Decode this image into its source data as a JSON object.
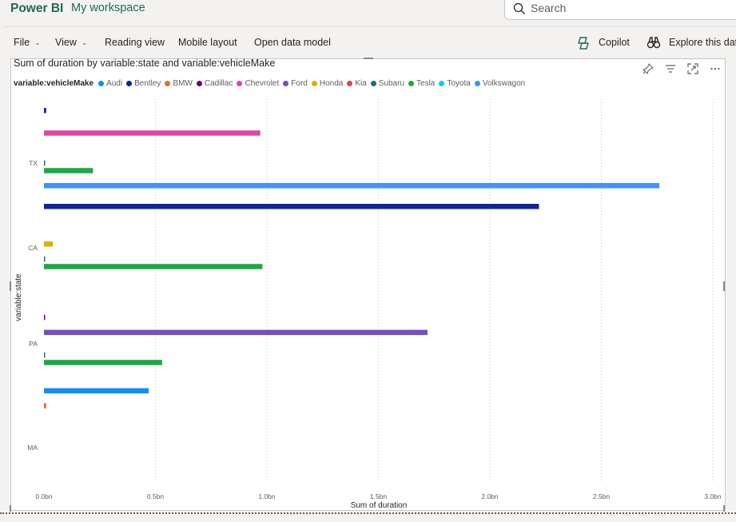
{
  "app": {
    "brand": "Power BI",
    "workspace": "My workspace"
  },
  "search": {
    "placeholder": "Search"
  },
  "toolbar": {
    "file": "File",
    "view": "View",
    "reading_view": "Reading view",
    "mobile_layout": "Mobile layout",
    "open_data_model": "Open data model",
    "copilot": "Copilot",
    "explore": "Explore this data"
  },
  "visual": {
    "title": "Sum of duration by variable:state and variable:vehicleMake",
    "legend_title": "variable:vehicleMake"
  },
  "colors": {
    "Audi": "#118dff",
    "Bentley": "#12239e",
    "BMW": "#e66c37",
    "Cadillac": "#6b007b",
    "Chevrolet": "#e044a7",
    "Ford": "#744ec2",
    "Honda": "#d9b300",
    "Kia": "#d64550",
    "Subaru": "#197278",
    "Tesla": "#1aab40",
    "Toyota": "#15c6f4",
    "Volkswagon": "#4092ff"
  },
  "chart_data": {
    "type": "bar",
    "orientation": "horizontal",
    "xlabel": "Sum of duration",
    "ylabel": "variable:state",
    "xlim": [
      0,
      3.0
    ],
    "x_unit": "bn",
    "x_ticks": [
      "0.0bn",
      "0.5bn",
      "1.0bn",
      "1.5bn",
      "2.0bn",
      "2.5bn",
      "3.0bn"
    ],
    "legend_position": "top-left",
    "grid": true,
    "categories": [
      "TX",
      "CA",
      "PA",
      "MA"
    ],
    "series_order": [
      "Audi",
      "Bentley",
      "BMW",
      "Cadillac",
      "Chevrolet",
      "Ford",
      "Honda",
      "Kia",
      "Subaru",
      "Tesla",
      "Toyota",
      "Volkswagon"
    ],
    "series": [
      {
        "name": "Audi",
        "values": [
          0,
          0,
          0,
          0.47
        ]
      },
      {
        "name": "Bentley",
        "values": [
          0.01,
          2.22,
          0,
          0
        ]
      },
      {
        "name": "BMW",
        "values": [
          0,
          0,
          0,
          0.01
        ]
      },
      {
        "name": "Cadillac",
        "values": [
          0,
          0,
          0.002,
          0
        ]
      },
      {
        "name": "Chevrolet",
        "values": [
          0.97,
          0,
          0,
          0
        ]
      },
      {
        "name": "Ford",
        "values": [
          0,
          0,
          1.72,
          0
        ]
      },
      {
        "name": "Honda",
        "values": [
          0,
          0.04,
          0,
          0
        ]
      },
      {
        "name": "Kia",
        "values": [
          0,
          0,
          0,
          0
        ]
      },
      {
        "name": "Subaru",
        "values": [
          0.002,
          0.002,
          0.002,
          0
        ]
      },
      {
        "name": "Tesla",
        "values": [
          0.22,
          0.98,
          0.53,
          0
        ]
      },
      {
        "name": "Toyota",
        "values": [
          0,
          0,
          0,
          0
        ]
      },
      {
        "name": "Volkswagon",
        "values": [
          2.76,
          0,
          0,
          0
        ]
      }
    ]
  }
}
